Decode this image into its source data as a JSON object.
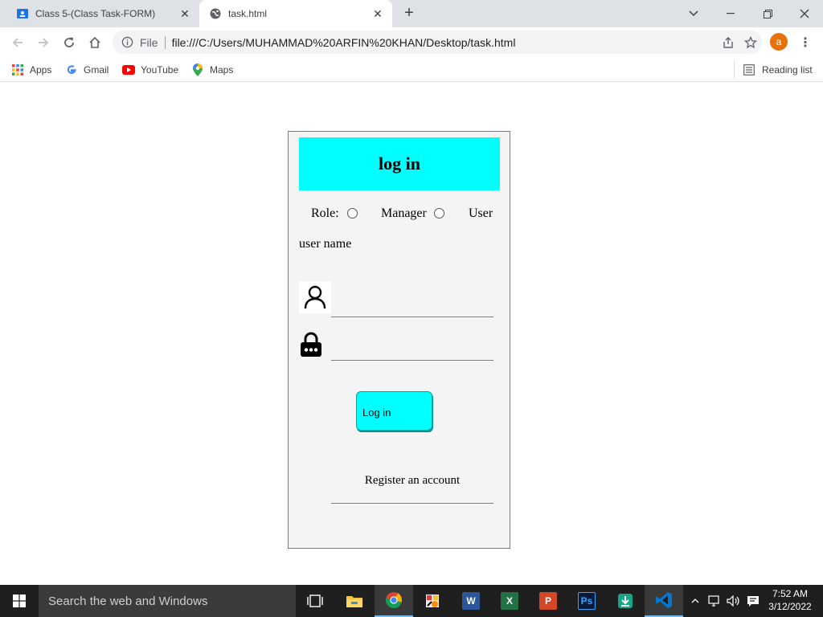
{
  "browser": {
    "tabs": [
      {
        "title": "Class 5-(Class Task-FORM)",
        "favicon": "classroom-icon",
        "active": false
      },
      {
        "title": "task.html",
        "favicon": "globe-icon",
        "active": true
      }
    ],
    "omnibox": {
      "security_label": "File",
      "url": "file:///C:/Users/MUHAMMAD%20ARFIN%20KHAN/Desktop/task.html"
    },
    "profile_initial": "a",
    "bookmarks": [
      {
        "label": "Apps",
        "icon": "apps-grid-icon"
      },
      {
        "label": "Gmail",
        "icon": "google-icon"
      },
      {
        "label": "YouTube",
        "icon": "youtube-icon"
      },
      {
        "label": "Maps",
        "icon": "maps-pin-icon"
      }
    ],
    "reading_list_label": "Reading list"
  },
  "form": {
    "heading": "log in",
    "role_label": "Role:",
    "role_options": [
      "Manager",
      "User"
    ],
    "username_label": "user name",
    "username_value": "",
    "password_value": "",
    "login_button": "Log in",
    "register_link": "Register an account",
    "accent_color": "#00ffff"
  },
  "taskbar": {
    "search_placeholder": "Search the web and Windows",
    "apps": [
      "task-view",
      "file-explorer",
      "chrome",
      "paint",
      "word",
      "excel",
      "powerpoint",
      "photoshop",
      "installer",
      "vscode"
    ],
    "time": "7:52 AM",
    "date": "3/12/2022"
  }
}
